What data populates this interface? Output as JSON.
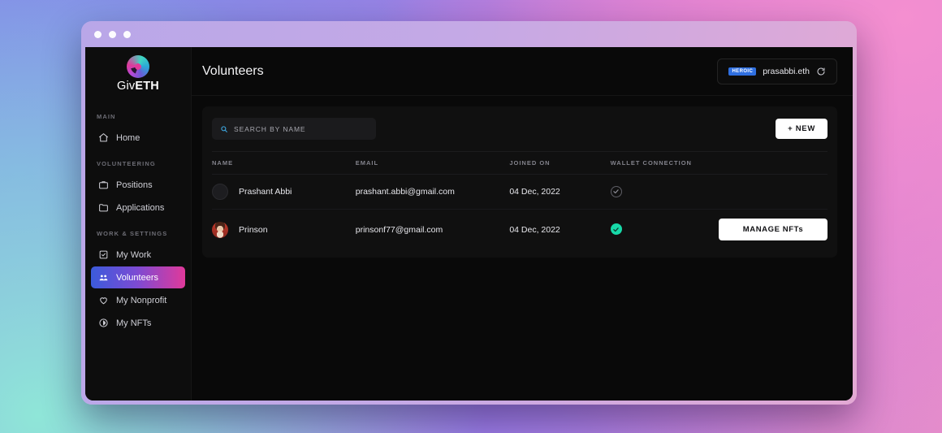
{
  "window": {
    "dots": [
      "close",
      "minimize",
      "maximize"
    ]
  },
  "sidebar": {
    "brand": {
      "name_light": "Giv",
      "name_bold": "ETH",
      "logo_icon": "giveth-logo-icon"
    },
    "sections": [
      {
        "label": "MAIN",
        "items": [
          {
            "label": "Home",
            "icon": "home-icon",
            "active": false
          }
        ]
      },
      {
        "label": "VOLUNTEERING",
        "items": [
          {
            "label": "Positions",
            "icon": "briefcase-icon",
            "active": false
          },
          {
            "label": "Applications",
            "icon": "folder-icon",
            "active": false
          }
        ]
      },
      {
        "label": "WORK & SETTINGS",
        "items": [
          {
            "label": "My Work",
            "icon": "checklist-icon",
            "active": false
          },
          {
            "label": "Volunteers",
            "icon": "people-icon",
            "active": true
          },
          {
            "label": "My Nonprofit",
            "icon": "heart-icon",
            "active": false
          },
          {
            "label": "My NFTs",
            "icon": "badge-icon",
            "active": false
          }
        ]
      }
    ]
  },
  "header": {
    "title": "Volunteers",
    "wallet": {
      "badge": "HEROIC",
      "address": "prasabbi.eth",
      "refresh_icon": "refresh-icon"
    }
  },
  "toolbar": {
    "search_placeholder": "SEARCH BY NAME",
    "search_value": "",
    "search_icon": "search-icon",
    "new_label": "+ NEW"
  },
  "table": {
    "columns": [
      "NAME",
      "EMAIL",
      "JOINED ON",
      "WALLET CONNECTION",
      ""
    ],
    "rows": [
      {
        "name": "Prashant Abbi",
        "email": "prashant.abbi@gmail.com",
        "joined_on": "04 Dec, 2022",
        "wallet_connected": false,
        "avatar": "empty",
        "action": ""
      },
      {
        "name": "Prinson",
        "email": "prinsonf77@gmail.com",
        "joined_on": "04 Dec, 2022",
        "wallet_connected": true,
        "avatar": "photo",
        "action": "MANAGE NFTs"
      }
    ]
  },
  "colors": {
    "accent_gradient_start": "#3b5bdb",
    "accent_gradient_end": "#e0399a",
    "success": "#17d9a8",
    "search_icon": "#3ea7e0",
    "badge_blue": "#2f6fe0"
  }
}
